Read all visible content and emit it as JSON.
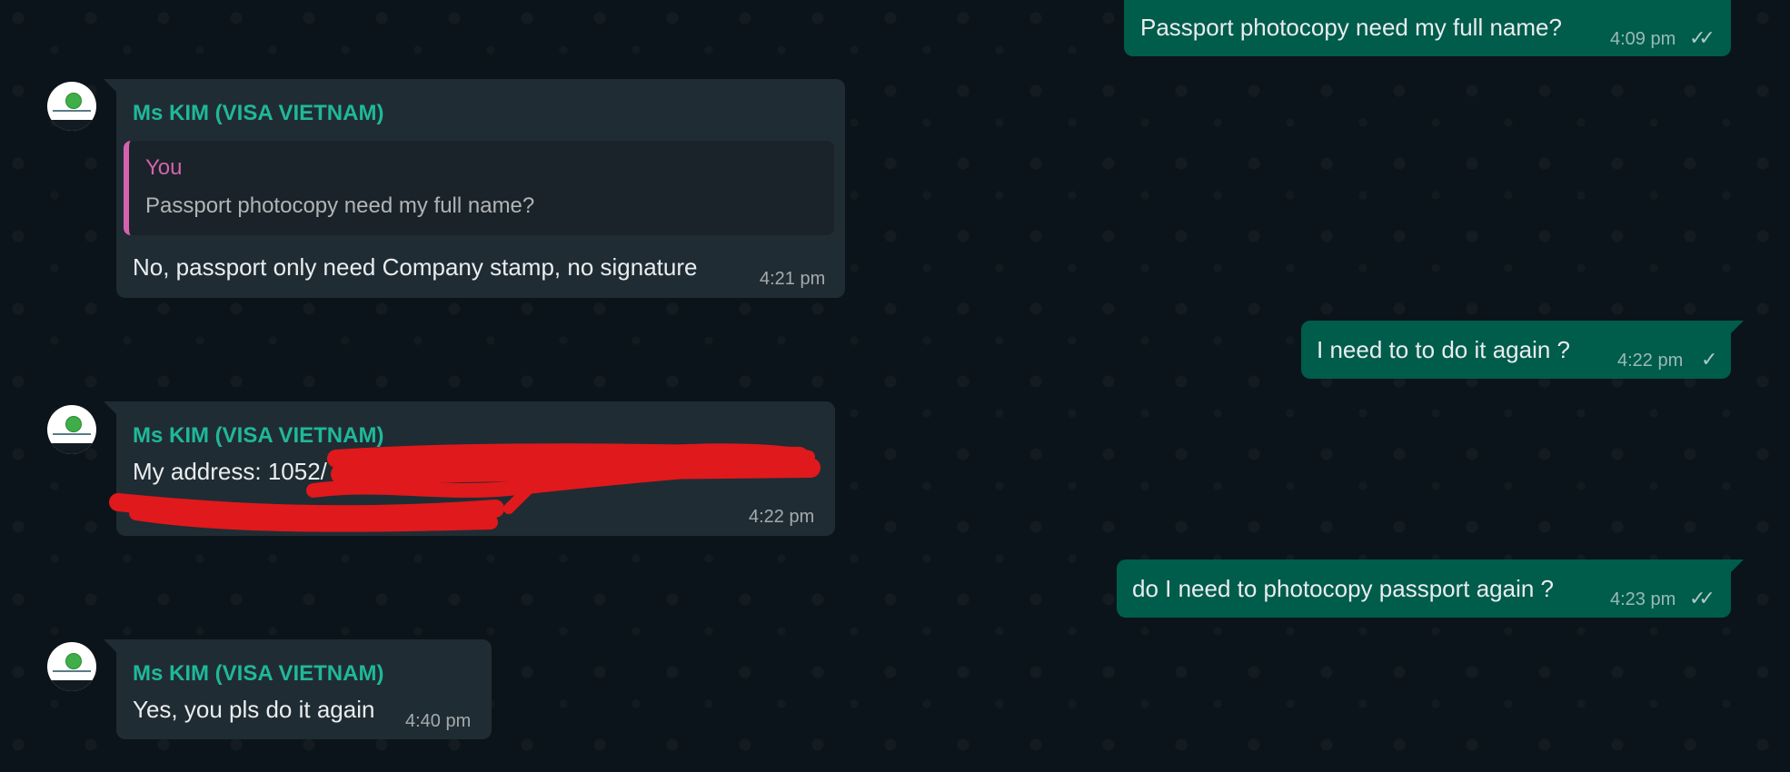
{
  "contact": {
    "name": "Ms KIM (VISA VIETNAM)"
  },
  "messages": [
    {
      "text": "Passport photocopy need my full name?",
      "time": "4:09 pm",
      "status": "read"
    },
    {
      "reply_to_name": "You",
      "reply_to_text": "Passport photocopy need my full name?",
      "text": "No, passport only need Company stamp, no signature",
      "time": "4:21 pm"
    },
    {
      "text": "I need to to do it again ?",
      "time": "4:22 pm",
      "status": "sent"
    },
    {
      "text": "My address: 1052/",
      "time": "4:22 pm"
    },
    {
      "text": "do I need to photocopy passport again ?",
      "time": "4:23 pm",
      "status": "read"
    },
    {
      "text": "Yes, you pls do it again",
      "time": "4:40 pm"
    }
  ],
  "icons": {
    "read": "double-check-icon",
    "sent": "single-check-icon",
    "avatar": "company-logo-avatar"
  },
  "colors": {
    "background": "#0b141a",
    "incoming_bubble": "#202c33",
    "outgoing_bubble": "#005c4b",
    "sender_name": "#1fb89a",
    "reply_accent": "#d462b1",
    "redaction": "#e0191c"
  }
}
